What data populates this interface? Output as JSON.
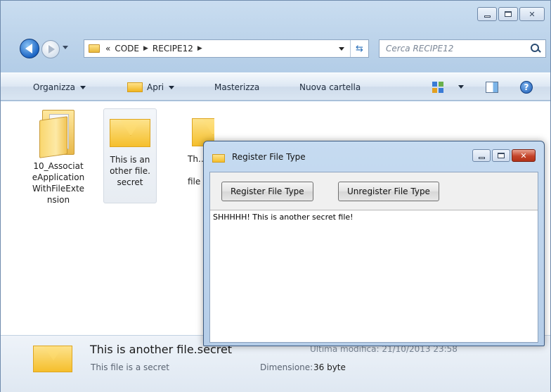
{
  "explorer": {
    "address": {
      "overflow": "«",
      "crumbs": [
        "CODE",
        "RECIPE12"
      ]
    },
    "search_placeholder": "Cerca RECIPE12",
    "toolbar": {
      "organize": "Organizza",
      "open": "Apri",
      "burn": "Masterizza",
      "new_folder": "Nuova cartella"
    },
    "files": [
      {
        "label": "10_AssociateApplicationWithFileExtension",
        "type": "folder"
      },
      {
        "label": "This is another file.secret",
        "type": "secret-file",
        "selected": true
      },
      {
        "label": "Th…",
        "type": "secret-file",
        "partial_label_bottom": "file"
      }
    ],
    "details": {
      "name": "This is another file.secret",
      "modified_label": "Ultima modifica: 21/10/2013 23:58",
      "type": "This file is a secret",
      "size_label": "Dimensione:",
      "size_value": "36 byte"
    }
  },
  "dialog": {
    "title": "Register File Type",
    "register_button": "Register File Type",
    "unregister_button": "Unregister File Type",
    "text_content": "SHHHHH! This is another secret file!"
  },
  "colors": {
    "accent": "#1d66c5",
    "close_red": "#c4442a",
    "envelope": "#f5bf2c"
  }
}
